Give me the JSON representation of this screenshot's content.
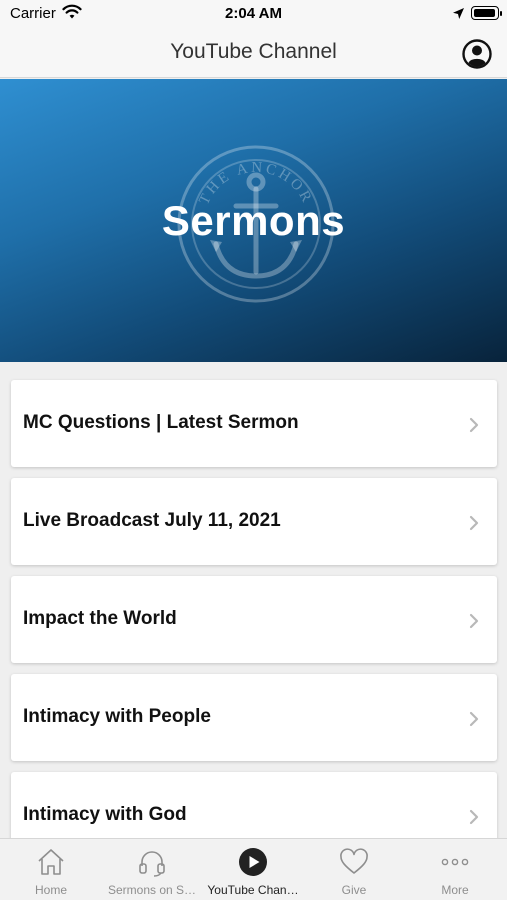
{
  "status_bar": {
    "carrier": "Carrier",
    "time": "2:04 AM"
  },
  "nav": {
    "title": "YouTube Channel"
  },
  "hero": {
    "title": "Sermons",
    "logo_text": "THE ANCHOR"
  },
  "list": {
    "items": [
      {
        "label": "MC Questions | Latest Sermon"
      },
      {
        "label": "Live Broadcast July 11, 2021"
      },
      {
        "label": "Impact the World"
      },
      {
        "label": "Intimacy with People"
      },
      {
        "label": "Intimacy with God"
      }
    ]
  },
  "tab_bar": {
    "active_index": 2,
    "tabs": [
      {
        "label": "Home",
        "icon": "home-icon"
      },
      {
        "label": "Sermons on S…",
        "icon": "headphones-icon"
      },
      {
        "label": "YouTube Chan…",
        "icon": "play-icon"
      },
      {
        "label": "Give",
        "icon": "heart-icon"
      },
      {
        "label": "More",
        "icon": "more-icon"
      }
    ]
  },
  "colors": {
    "hero_start": "#2f8fd1",
    "hero_end": "#08233b",
    "active_tab": "#222222",
    "inactive_tab": "#8e8e8e"
  }
}
